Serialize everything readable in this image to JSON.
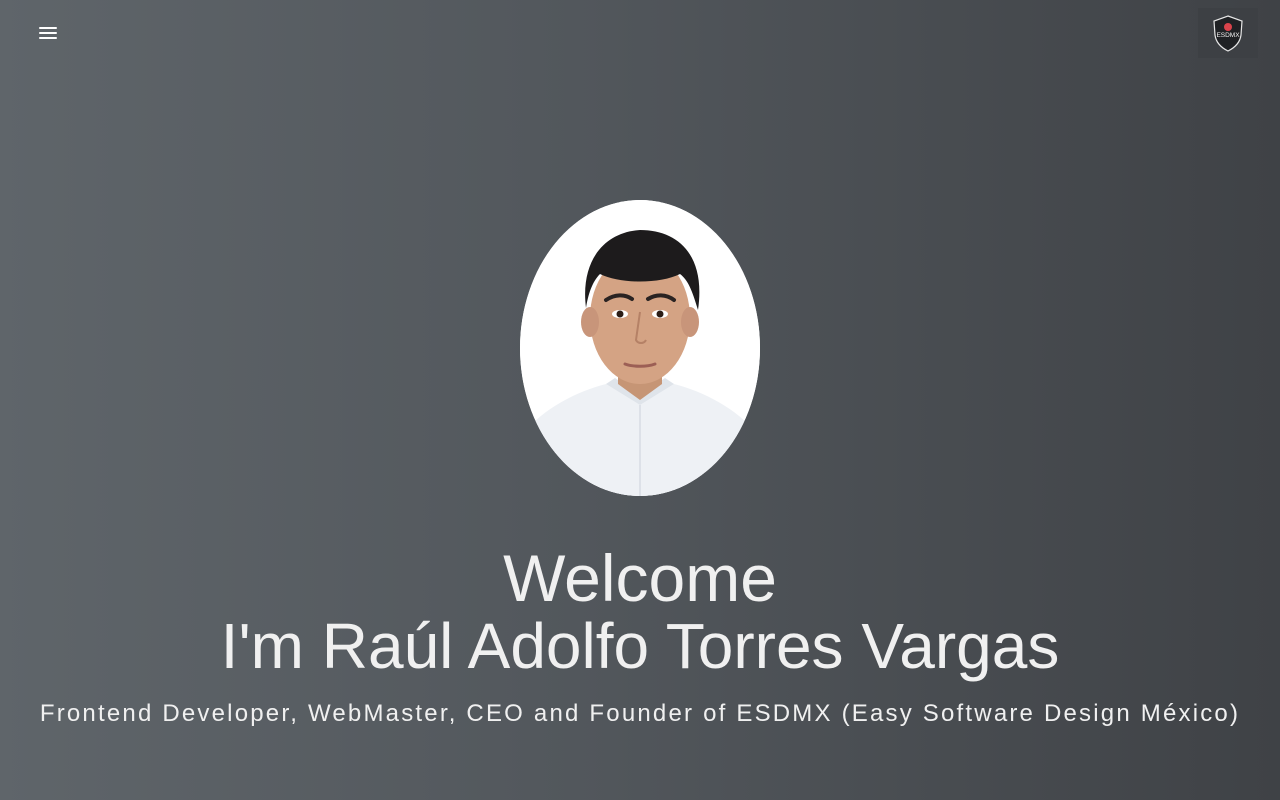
{
  "nav": {
    "menu_icon": "hamburger-menu-icon",
    "logo_text": "ESDMX",
    "logo_accent_color": "#d9434b"
  },
  "hero": {
    "welcome": "Welcome",
    "name": "I'm Raúl Adolfo Torres Vargas",
    "subtitle": "Frontend Developer, WebMaster, CEO and Founder of ESDMX (Easy Software Design México)"
  },
  "colors": {
    "background_left": "#5f656a",
    "background_right": "#3f4246",
    "text": "#f0f0f0"
  }
}
